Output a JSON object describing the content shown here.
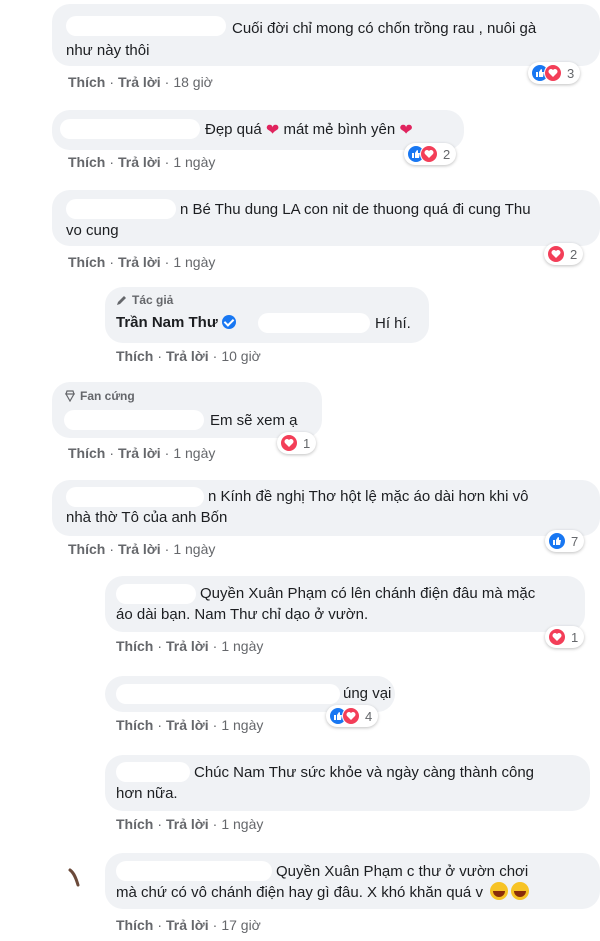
{
  "comments": [
    {
      "text1": "Cuối đời chỉ mong có chốn trồng rau , nuôi gà",
      "text2": "như này thôi",
      "like": "Thích",
      "reply": "Trả lời",
      "time": "18 giờ",
      "reacts": "3"
    },
    {
      "text1": "Đẹp quá",
      "text1b": "mát mẻ bình yên",
      "like": "Thích",
      "reply": "Trả lời",
      "time": "1 ngày",
      "reacts": "2"
    },
    {
      "text1": "n Bé Thu dung LA con nit de thuong quá đi cung Thu",
      "text2": "vo cung",
      "like": "Thích",
      "reply": "Trả lời",
      "time": "1 ngày",
      "reacts": "2"
    },
    {
      "badge": "Tác giả",
      "name": "Trần Nam Thư",
      "text1": "Hí hí.",
      "like": "Thích",
      "reply": "Trả lời",
      "time": "10 giờ"
    },
    {
      "badge": "Fan cứng",
      "text1": "Em sẽ xem ạ",
      "like": "Thích",
      "reply": "Trả lời",
      "time": "1 ngày",
      "reacts": "1"
    },
    {
      "text1": "n Kính đề nghị Thơ hột lệ mặc áo dài hơn khi vô",
      "text2": "nhà thờ Tô của anh Bốn",
      "like": "Thích",
      "reply": "Trả lời",
      "time": "1 ngày",
      "reacts": "7"
    },
    {
      "text1": "Quyền Xuân Phạm có lên chánh điện đâu mà mặc",
      "text2": "áo dài bạn. Nam Thư chỉ dạo ở vườn.",
      "like": "Thích",
      "reply": "Trả lời",
      "time": "1 ngày",
      "reacts": "1"
    },
    {
      "text1": "úng vại",
      "like": "Thích",
      "reply": "Trả lời",
      "time": "1 ngày",
      "reacts": "4"
    },
    {
      "text1": "Chúc Nam Thư sức khỏe và ngày càng thành công",
      "text2": "hơn nữa.",
      "like": "Thích",
      "reply": "Trả lời",
      "time": "1 ngày"
    },
    {
      "text1": "Quyền Xuân Phạm c thư ở vườn chơi",
      "text2": "mà chứ có vô chánh điện hay gì đâu. X khó khăn quá v",
      "like": "Thích",
      "reply": "Trả lời",
      "time": "17 giờ"
    }
  ],
  "icons": {
    "like": "like-icon",
    "love": "love-icon",
    "pencil": "pencil-icon",
    "diamond": "diamond-icon",
    "verified": "verified-badge-icon",
    "laugh": "laughing-emoji-icon"
  },
  "colors": {
    "bubble": "#f0f2f5",
    "link": "#65676b",
    "like": "#1877f2",
    "love": "#f33e58"
  }
}
